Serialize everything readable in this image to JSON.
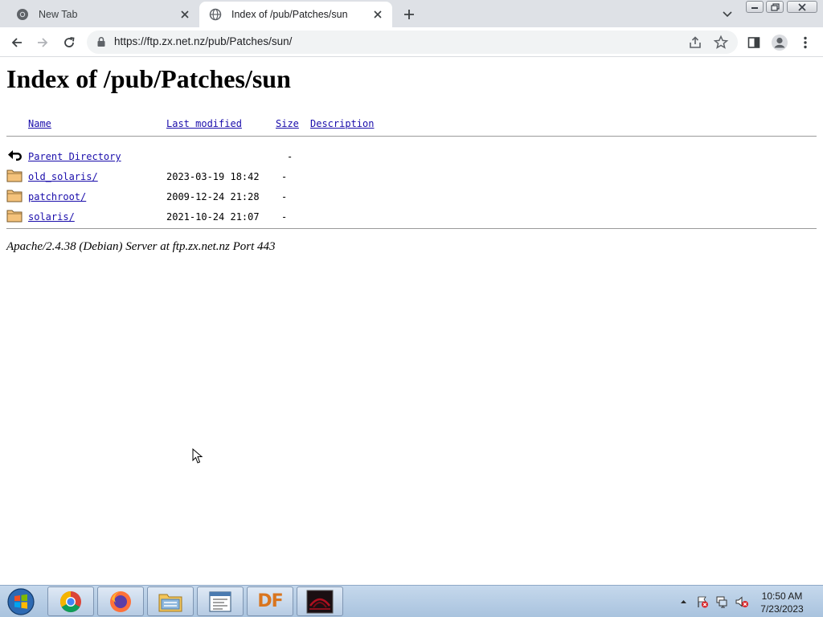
{
  "browser": {
    "tabs": [
      {
        "title": "New Tab",
        "favicon": "chrome-icon",
        "active": false
      },
      {
        "title": "Index of /pub/Patches/sun",
        "favicon": "globe-icon",
        "active": true
      }
    ],
    "address_bar": {
      "url": "https://ftp.zx.net.nz/pub/Patches/sun/"
    }
  },
  "page": {
    "heading": "Index of /pub/Patches/sun",
    "columns": {
      "name": "Name",
      "last_modified": "Last modified",
      "size": "Size",
      "description": "Description"
    },
    "entries": [
      {
        "icon": "back-arrow-icon",
        "name": "Parent Directory",
        "modified": "",
        "size": "-"
      },
      {
        "icon": "folder-icon",
        "name": "old_solaris/",
        "modified": "2023-03-19 18:42",
        "size": "-"
      },
      {
        "icon": "folder-icon",
        "name": "patchroot/",
        "modified": "2009-12-24 21:28",
        "size": "-"
      },
      {
        "icon": "folder-icon",
        "name": "solaris/",
        "modified": "2021-10-24 21:07",
        "size": "-"
      }
    ],
    "footer": "Apache/2.4.38 (Debian) Server at ftp.zx.net.nz Port 443"
  },
  "taskbar": {
    "apps": [
      "chrome",
      "firefox",
      "file-explorer",
      "notepad",
      "DF",
      "app-thumbnail"
    ],
    "df_label": "DF",
    "clock": {
      "time": "10:50 AM",
      "date": "7/23/2023"
    }
  },
  "colors": {
    "link": "#1a0dab",
    "tabstrip": "#dee1e6",
    "taskbar": "#b6cbe3"
  }
}
